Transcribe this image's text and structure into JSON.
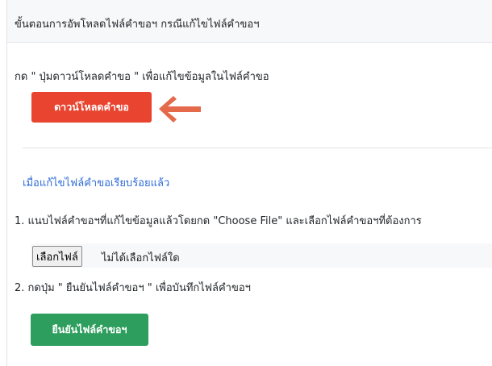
{
  "header": {
    "title": "ขั้นตอนการอัพโหลดไฟล์คำขอฯ กรณีแก้ไขไฟล์คำขอฯ"
  },
  "instructions": {
    "download_hint": "กด \" ปุ่มดาวน์โหลดคำขอ \" เพื่อแก้ไขข้อมูลในไฟล์คำขอ",
    "after_edit_title": "เมื่อแก้ไขไฟล์คำขอเรียบร้อยแล้ว",
    "step1": "1. แนบไฟล์คำขอฯที่แก้ไขข้อมูลแล้วโดยกด \"Choose File\" และเลือกไฟล์คำขอฯที่ต้องการ",
    "step2": "2. กดปุ่ม \" ยืนยันไฟล์คำขอฯ \" เพื่อบันทึกไฟล์คำขอฯ"
  },
  "buttons": {
    "download": "ดาวน์โหลดคำขอ",
    "choose_file": "เลือกไฟล์",
    "confirm": "ยืนยันไฟล์คำขอฯ"
  },
  "file_input": {
    "status": "ไม่ได้เลือกไฟล์ใด"
  },
  "icons": {
    "arrow": "arrow-left-icon"
  },
  "colors": {
    "download_button": "#e8442f",
    "confirm_button": "#2e9e5e",
    "arrow": "#e46a4b",
    "link_title": "#2f6bd8"
  }
}
